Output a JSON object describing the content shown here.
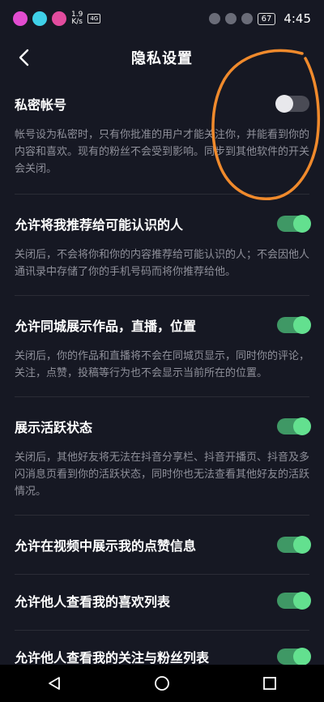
{
  "status_bar": {
    "net_speed_value": "1.9",
    "net_speed_unit": "K/s",
    "small_icon_text": "4G",
    "battery": "67",
    "time": "4:45"
  },
  "header": {
    "title": "隐私设置",
    "back_icon": "chevron-left-icon"
  },
  "settings": [
    {
      "label": "私密帐号",
      "desc": "帐号设为私密时，只有你批准的用户才能关注你，并能看到你的内容和喜欢。现有的粉丝不会受到影响。同步到其他软件的开关会关闭。",
      "state": "off"
    },
    {
      "label": "允许将我推荐给可能认识的人",
      "desc": "关闭后，不会将你和你的内容推荐给可能认识的人；不会因他人通讯录中存储了你的手机号码而将你推荐给他。",
      "state": "on"
    },
    {
      "label": "允许同城展示作品，直播，位置",
      "desc": "关闭后，你的作品和直播将不会在同城页显示，同时你的评论，关注，点赞，投稿等行为也不会显示当前所在的位置。",
      "state": "on"
    },
    {
      "label": "展示活跃状态",
      "desc": "关闭后，其他好友将无法在抖音分享栏、抖音开播页、抖音及多闪消息页看到你的活跃状态，同时你也无法查看其他好友的活跃情况。",
      "state": "on"
    },
    {
      "label": "允许在视频中展示我的点赞信息",
      "state": "on"
    },
    {
      "label": "允许他人查看我的喜欢列表",
      "state": "on"
    },
    {
      "label": "允许他人查看我的关注与粉丝列表",
      "state": "on"
    }
  ],
  "colors": {
    "background": "#161823",
    "toggle_on_track": "#3f9865",
    "toggle_on_knob": "#63e08f",
    "toggle_off_track": "#4a4b55",
    "annotation": "#f08a2c"
  },
  "nav_bar": {
    "back_icon": "triangle-back-icon",
    "home_icon": "circle-home-icon",
    "recents_icon": "square-recents-icon"
  }
}
